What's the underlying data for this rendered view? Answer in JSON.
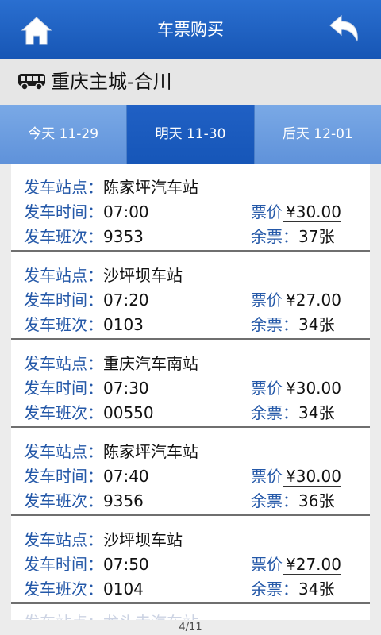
{
  "header": {
    "title": "车票购买"
  },
  "route": {
    "name": "重庆主城-合川"
  },
  "tabs": [
    {
      "label": "今天 11-29"
    },
    {
      "label": "明天 11-30",
      "active": true
    },
    {
      "label": "后天 12-01"
    }
  ],
  "labels": {
    "station": "发车站点：",
    "time": "发车时间：",
    "trip": "发车班次：",
    "price": "票价",
    "remaining": "余票："
  },
  "trips": [
    {
      "station": "陈家坪汽车站",
      "time": "07:00",
      "trip": "9353",
      "price": "¥30.00",
      "remaining": "37张"
    },
    {
      "station": "沙坪坝车站",
      "time": "07:20",
      "trip": "0103",
      "price": "¥27.00",
      "remaining": "34张"
    },
    {
      "station": "重庆汽车南站",
      "time": "07:30",
      "trip": "00550",
      "price": "¥30.00",
      "remaining": "34张"
    },
    {
      "station": "陈家坪汽车站",
      "time": "07:40",
      "trip": "9356",
      "price": "¥30.00",
      "remaining": "36张"
    },
    {
      "station": "沙坪坝车站",
      "time": "07:50",
      "trip": "0104",
      "price": "¥27.00",
      "remaining": "34张"
    }
  ],
  "partial_item": "发车站点：龙头寺汽车站",
  "pager": {
    "text": "4/11"
  },
  "colors": {
    "header": "#1e63c8",
    "active_tab": "#1a5ac0",
    "tab": "#6a9cdf",
    "label": "#2458a8"
  }
}
